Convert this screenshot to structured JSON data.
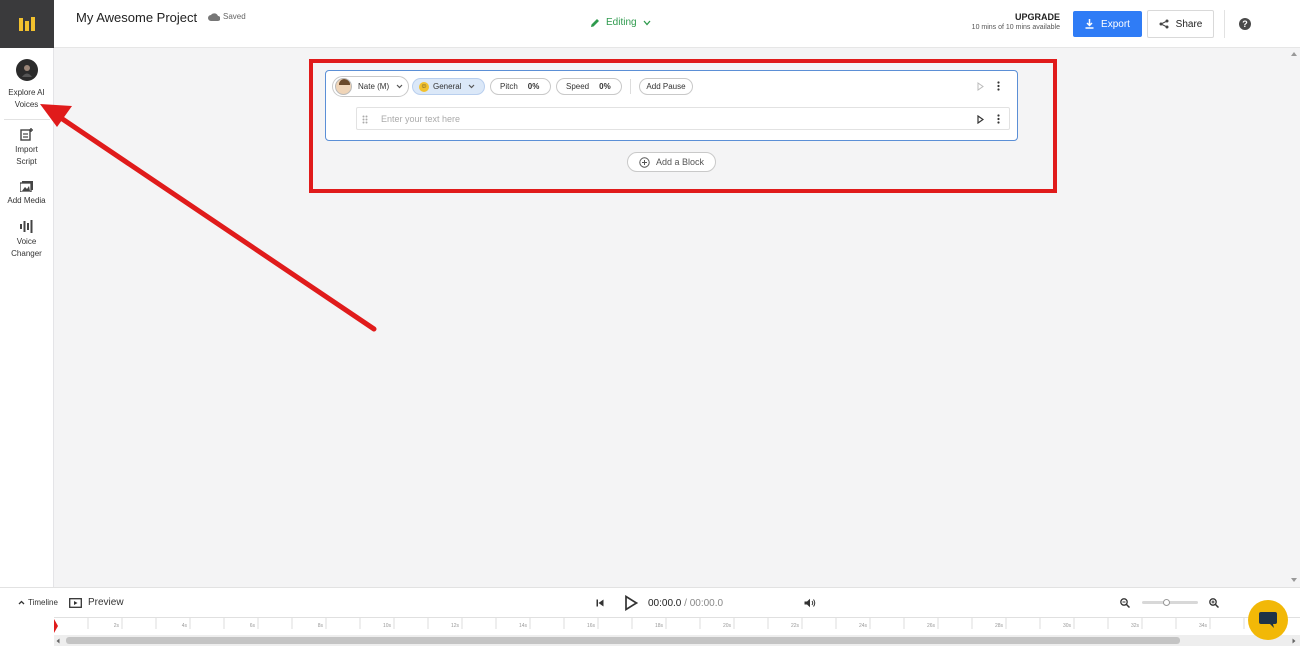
{
  "sidebar": {
    "items": [
      {
        "label": "Explore AI Voices",
        "icon": "ai-voice-avatar-icon"
      },
      {
        "label": "Import Script",
        "icon": "import-script-icon"
      },
      {
        "label": "Add Media",
        "icon": "add-media-icon"
      },
      {
        "label": "Voice Changer",
        "icon": "voice-changer-icon"
      }
    ]
  },
  "header": {
    "project_title": "My Awesome Project",
    "saved_label": "Saved",
    "mode_label": "Editing",
    "upgrade_label": "UPGRADE",
    "usage_text": "10 mins of 10 mins available",
    "export_label": "Export",
    "share_label": "Share"
  },
  "block": {
    "voice_name": "Nate (M)",
    "style_label": "General",
    "pitch_label": "Pitch",
    "pitch_value": "0%",
    "speed_label": "Speed",
    "speed_value": "0%",
    "add_pause_label": "Add Pause",
    "text_placeholder": "Enter your text here"
  },
  "add_block_label": "Add a Block",
  "timeline": {
    "timeline_label": "Timeline",
    "preview_label": "Preview",
    "current_time": "00:00.0",
    "separator": "/",
    "total_time": "00:00.0",
    "ticks": [
      "2s",
      "4s",
      "6s",
      "8s",
      "10s",
      "12s",
      "14s",
      "16s",
      "18s",
      "20s",
      "22s",
      "24s",
      "26s",
      "28s",
      "30s",
      "32s",
      "34s"
    ]
  },
  "colors": {
    "accent_blue": "#2f7cf6",
    "editing_green": "#2e9a4d",
    "highlight_red": "#e01b1b",
    "chat_yellow": "#f2b807"
  }
}
